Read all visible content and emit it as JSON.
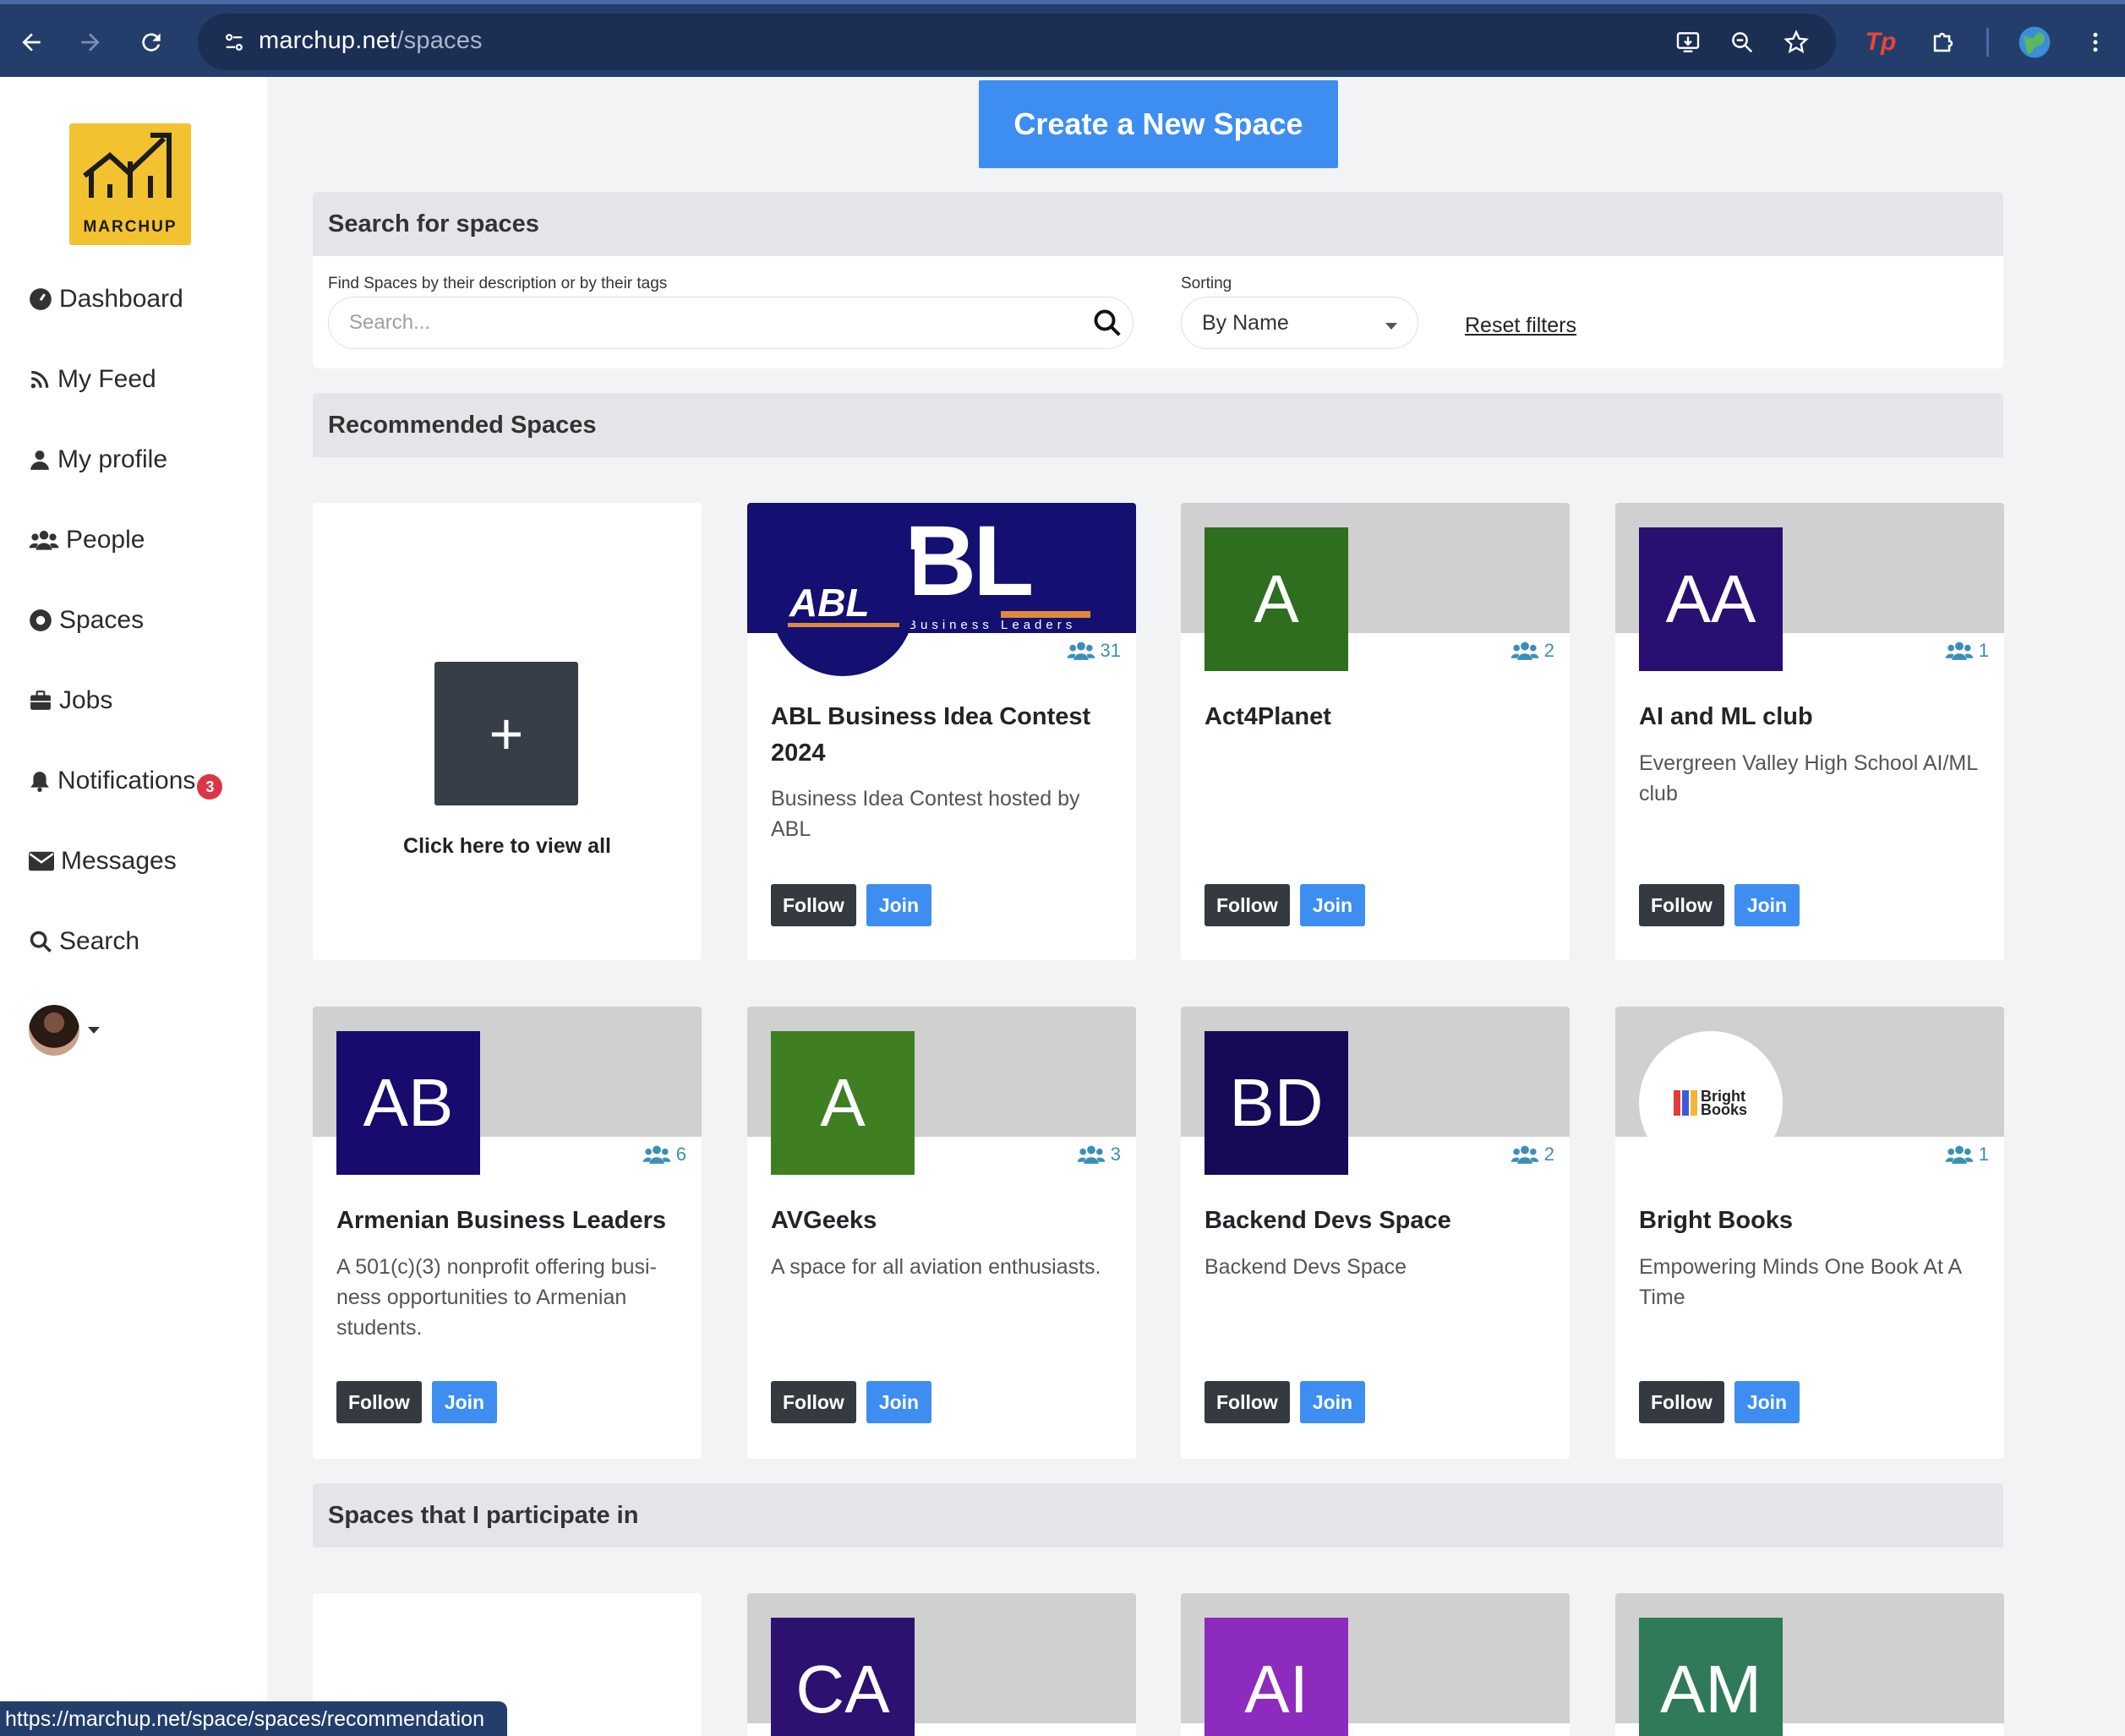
{
  "browser": {
    "url_domain": "marchup.net",
    "url_path": "/spaces",
    "status_url": "https://marchup.net/space/spaces/recommendation"
  },
  "sidebar": {
    "logo_text": "MARCHUP",
    "items": [
      {
        "label": "Dashboard",
        "icon": "dashboard-icon"
      },
      {
        "label": "My Feed",
        "icon": "rss-icon"
      },
      {
        "label": "My profile",
        "icon": "user-icon"
      },
      {
        "label": "People",
        "icon": "people-icon"
      },
      {
        "label": "Spaces",
        "icon": "spaces-icon"
      },
      {
        "label": "Jobs",
        "icon": "briefcase-icon"
      },
      {
        "label": "Notifications",
        "icon": "bell-icon",
        "badge": "3"
      },
      {
        "label": "Messages",
        "icon": "envelope-icon"
      },
      {
        "label": "Search",
        "icon": "search-icon"
      }
    ]
  },
  "main": {
    "create_button": "Create a New Space",
    "search_section": {
      "title": "Search for spaces",
      "search_label": "Find Spaces by their description or by their tags",
      "search_placeholder": "Search...",
      "sorting_label": "Sorting",
      "sorting_value": "By Name",
      "reset_label": "Reset filters"
    },
    "recommended_title": "Recommended Spaces",
    "view_all_label": "Click here to view all",
    "follow_label": "Follow",
    "join_label": "Join",
    "recommended": [
      {
        "name": "ABL Business Idea Contest 2024",
        "description": "Business Idea Contest hosted by ABL",
        "members": "31",
        "initials": "",
        "color": "#141072"
      },
      {
        "name": "Act4Planet",
        "description": "",
        "members": "2",
        "initials": "A",
        "color": "#2d6e1f"
      },
      {
        "name": "AI and ML club",
        "description": "Evergreen Valley High School AI/ML club",
        "members": "1",
        "initials": "AA",
        "color": "#2a0f73"
      },
      {
        "name": "Armenian Business Leaders",
        "description": "A 501(c)(3) nonprofit offering busi-ness opportunities to Armenian students.",
        "members": "6",
        "initials": "AB",
        "color": "#170b6e"
      },
      {
        "name": "AVGeeks",
        "description": "A space for all aviation enthusiasts.",
        "members": "3",
        "initials": "A",
        "color": "#3f7f22"
      },
      {
        "name": "Backend Devs Space",
        "description": "Backend Devs Space",
        "members": "2",
        "initials": "BD",
        "color": "#140a57"
      },
      {
        "name": "Bright Books",
        "description": "Empowering Minds One Book At A Time",
        "members": "1",
        "initials": "",
        "color": "#ffffff"
      }
    ],
    "participate_title": "Spaces that I participate in",
    "participate": [
      {
        "initials": "CA",
        "color": "#2d1170"
      },
      {
        "initials": "AI",
        "color": "#8c2bbd"
      },
      {
        "initials": "AM",
        "color": "#2f7b59"
      }
    ],
    "abl_banner": {
      "big": "BL",
      "small": "ABL",
      "sub": "Business Leaders"
    },
    "bright_books_logo": "Bright Books"
  }
}
